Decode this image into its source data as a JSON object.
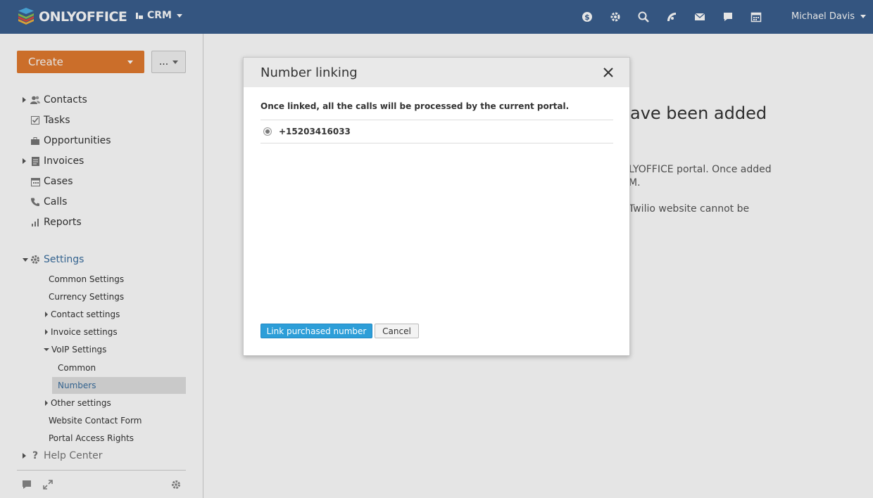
{
  "header": {
    "logo_text": "ONLYOFFICE",
    "module_label": "CRM",
    "user_name": "Michael Davis",
    "icons": [
      "dollar-icon",
      "settings-gear-icon",
      "search-icon",
      "feed-icon",
      "mail-icon",
      "chat-icon",
      "calendar-icon"
    ]
  },
  "sidebar": {
    "create_label": "Create",
    "more_label": "...",
    "items": [
      {
        "label": "Contacts"
      },
      {
        "label": "Tasks"
      },
      {
        "label": "Opportunities"
      },
      {
        "label": "Invoices"
      },
      {
        "label": "Cases"
      },
      {
        "label": "Calls"
      },
      {
        "label": "Reports"
      }
    ],
    "settings_label": "Settings",
    "settings_items": [
      {
        "label": "Common Settings"
      },
      {
        "label": "Currency Settings"
      },
      {
        "label": "Contact settings"
      },
      {
        "label": "Invoice settings"
      },
      {
        "label": "VoIP Settings"
      },
      {
        "label": "Common"
      },
      {
        "label": "Numbers"
      },
      {
        "label": "Other settings"
      },
      {
        "label": "Website Contact Form"
      },
      {
        "label": "Portal Access Rights"
      }
    ],
    "help_label": "Help Center"
  },
  "main": {
    "title_fragment": "ave been added",
    "para1_line1": "LYOFFICE portal. Once added",
    "para1_line2": "M.",
    "para2": "Twilio website cannot be"
  },
  "modal": {
    "title": "Number linking",
    "description": "Once linked, all the calls will be processed by the current portal.",
    "number": "+15203416033",
    "primary_button": "Link purchased number",
    "cancel_button": "Cancel"
  },
  "colors": {
    "header_bg": "#3a5f8f",
    "create_button": "#e27b2f",
    "primary_button": "#2d9ed8",
    "link_blue": "#3a6fa0"
  }
}
